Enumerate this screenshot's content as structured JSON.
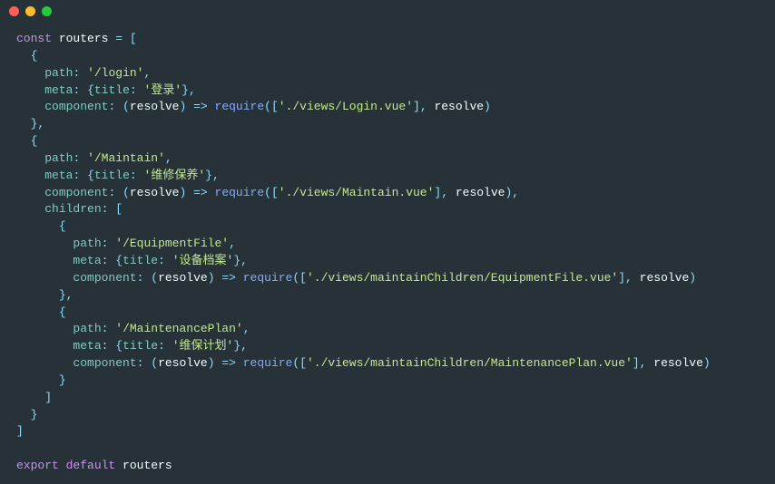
{
  "code": {
    "decl_kw": "const",
    "decl_name": "routers",
    "eq": "=",
    "export_kw": "export",
    "default_kw": "default",
    "export_name": "routers",
    "arrow": "=>",
    "require": "require",
    "route1": {
      "path_key": "path",
      "path_val": "'/login'",
      "meta_key": "meta",
      "title_key": "title",
      "title_val": "'登录'",
      "comp_key": "component",
      "resolve": "resolve",
      "req_arg": "'./views/Login.vue'"
    },
    "route2": {
      "path_key": "path",
      "path_val": "'/Maintain'",
      "meta_key": "meta",
      "title_key": "title",
      "title_val": "'维修保养'",
      "comp_key": "component",
      "resolve": "resolve",
      "req_arg": "'./views/Maintain.vue'",
      "children_key": "children"
    },
    "child1": {
      "path_key": "path",
      "path_val": "'/EquipmentFile'",
      "meta_key": "meta",
      "title_key": "title",
      "title_val": "'设备档案'",
      "comp_key": "component",
      "resolve": "resolve",
      "req_arg": "'./views/maintainChildren/EquipmentFile.vue'"
    },
    "child2": {
      "path_key": "path",
      "path_val": "'/MaintenancePlan'",
      "meta_key": "meta",
      "title_key": "title",
      "title_val": "'维保计划'",
      "comp_key": "component",
      "resolve": "resolve",
      "req_arg": "'./views/maintainChildren/MaintenancePlan.vue'"
    }
  }
}
